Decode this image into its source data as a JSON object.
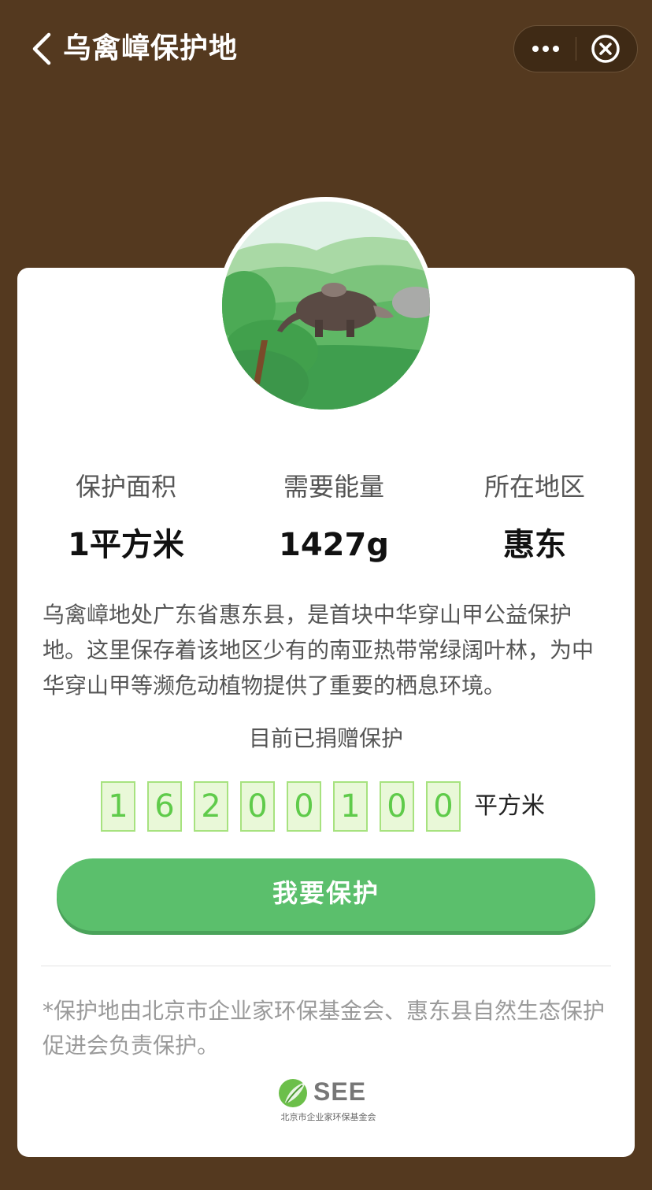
{
  "nav": {
    "title": "乌禽嶂保护地"
  },
  "stats": [
    {
      "label": "保护面积",
      "value": "1平方米"
    },
    {
      "label": "需要能量",
      "value": "1427g"
    },
    {
      "label": "所在地区",
      "value": "惠东"
    }
  ],
  "description": "乌禽嶂地处广东省惠东县，是首块中华穿山甲公益保护地。这里保存着该地区少有的南亚热带常绿阔叶林，为中华穿山甲等濒危动植物提供了重要的栖息环境。",
  "donated": {
    "label": "目前已捐赠保护",
    "digits": [
      "1",
      "6",
      "2",
      "0",
      "0",
      "1",
      "0",
      "0"
    ],
    "unit": "平方米"
  },
  "action": {
    "protect_label": "我要保护"
  },
  "footer": {
    "note": "*保护地由北京市企业家环保基金会、惠东县自然生态保护促进会负责保护。",
    "logo_text": "SEE",
    "logo_sub": "北京市企业家环保基金会"
  },
  "colors": {
    "nav_background": "#54391f",
    "button_green": "#5bbf6c",
    "digit_text": "#5fcb4a",
    "digit_border": "#a7e27f"
  }
}
